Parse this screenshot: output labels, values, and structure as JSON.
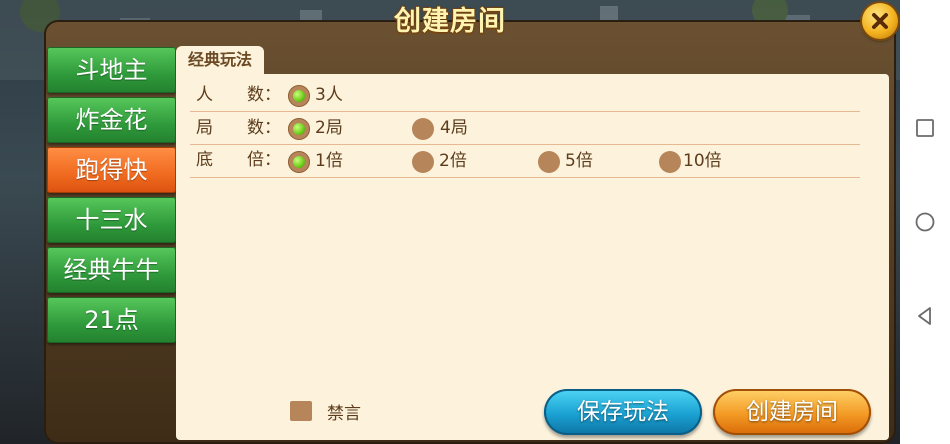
{
  "dialog": {
    "title": "创建房间"
  },
  "games": [
    {
      "label": "斗地主",
      "selected": false
    },
    {
      "label": "炸金花",
      "selected": false
    },
    {
      "label": "跑得快",
      "selected": true
    },
    {
      "label": "十三水",
      "selected": false
    },
    {
      "label": "经典牛牛",
      "selected": false
    },
    {
      "label": "21点",
      "selected": false
    }
  ],
  "tab": {
    "label": "经典玩法"
  },
  "rules": {
    "players": {
      "label": "人　　数：",
      "options": [
        {
          "label": "3人",
          "selected": true
        }
      ]
    },
    "rounds": {
      "label": "局　　数：",
      "options": [
        {
          "label": "2局",
          "selected": true
        },
        {
          "label": "4局",
          "selected": false
        }
      ]
    },
    "multiplier": {
      "label": "底　　倍：",
      "options": [
        {
          "label": "1倍",
          "selected": true
        },
        {
          "label": "2倍",
          "selected": false
        },
        {
          "label": "5倍",
          "selected": false
        },
        {
          "label": "10倍",
          "selected": false
        }
      ]
    }
  },
  "mute": {
    "label": "禁言",
    "checked": false
  },
  "buttons": {
    "save": "保存玩法",
    "create": "创建房间"
  },
  "colors": {
    "accent_green": "#2f9a3b",
    "accent_orange": "#f06a1f",
    "panel_bg": "#fdf3dc",
    "text_brown": "#5c3c1c"
  },
  "icons": {
    "close": "close-icon",
    "nav_recents": "square-icon",
    "nav_home": "circle-icon",
    "nav_back": "triangle-back-icon"
  }
}
